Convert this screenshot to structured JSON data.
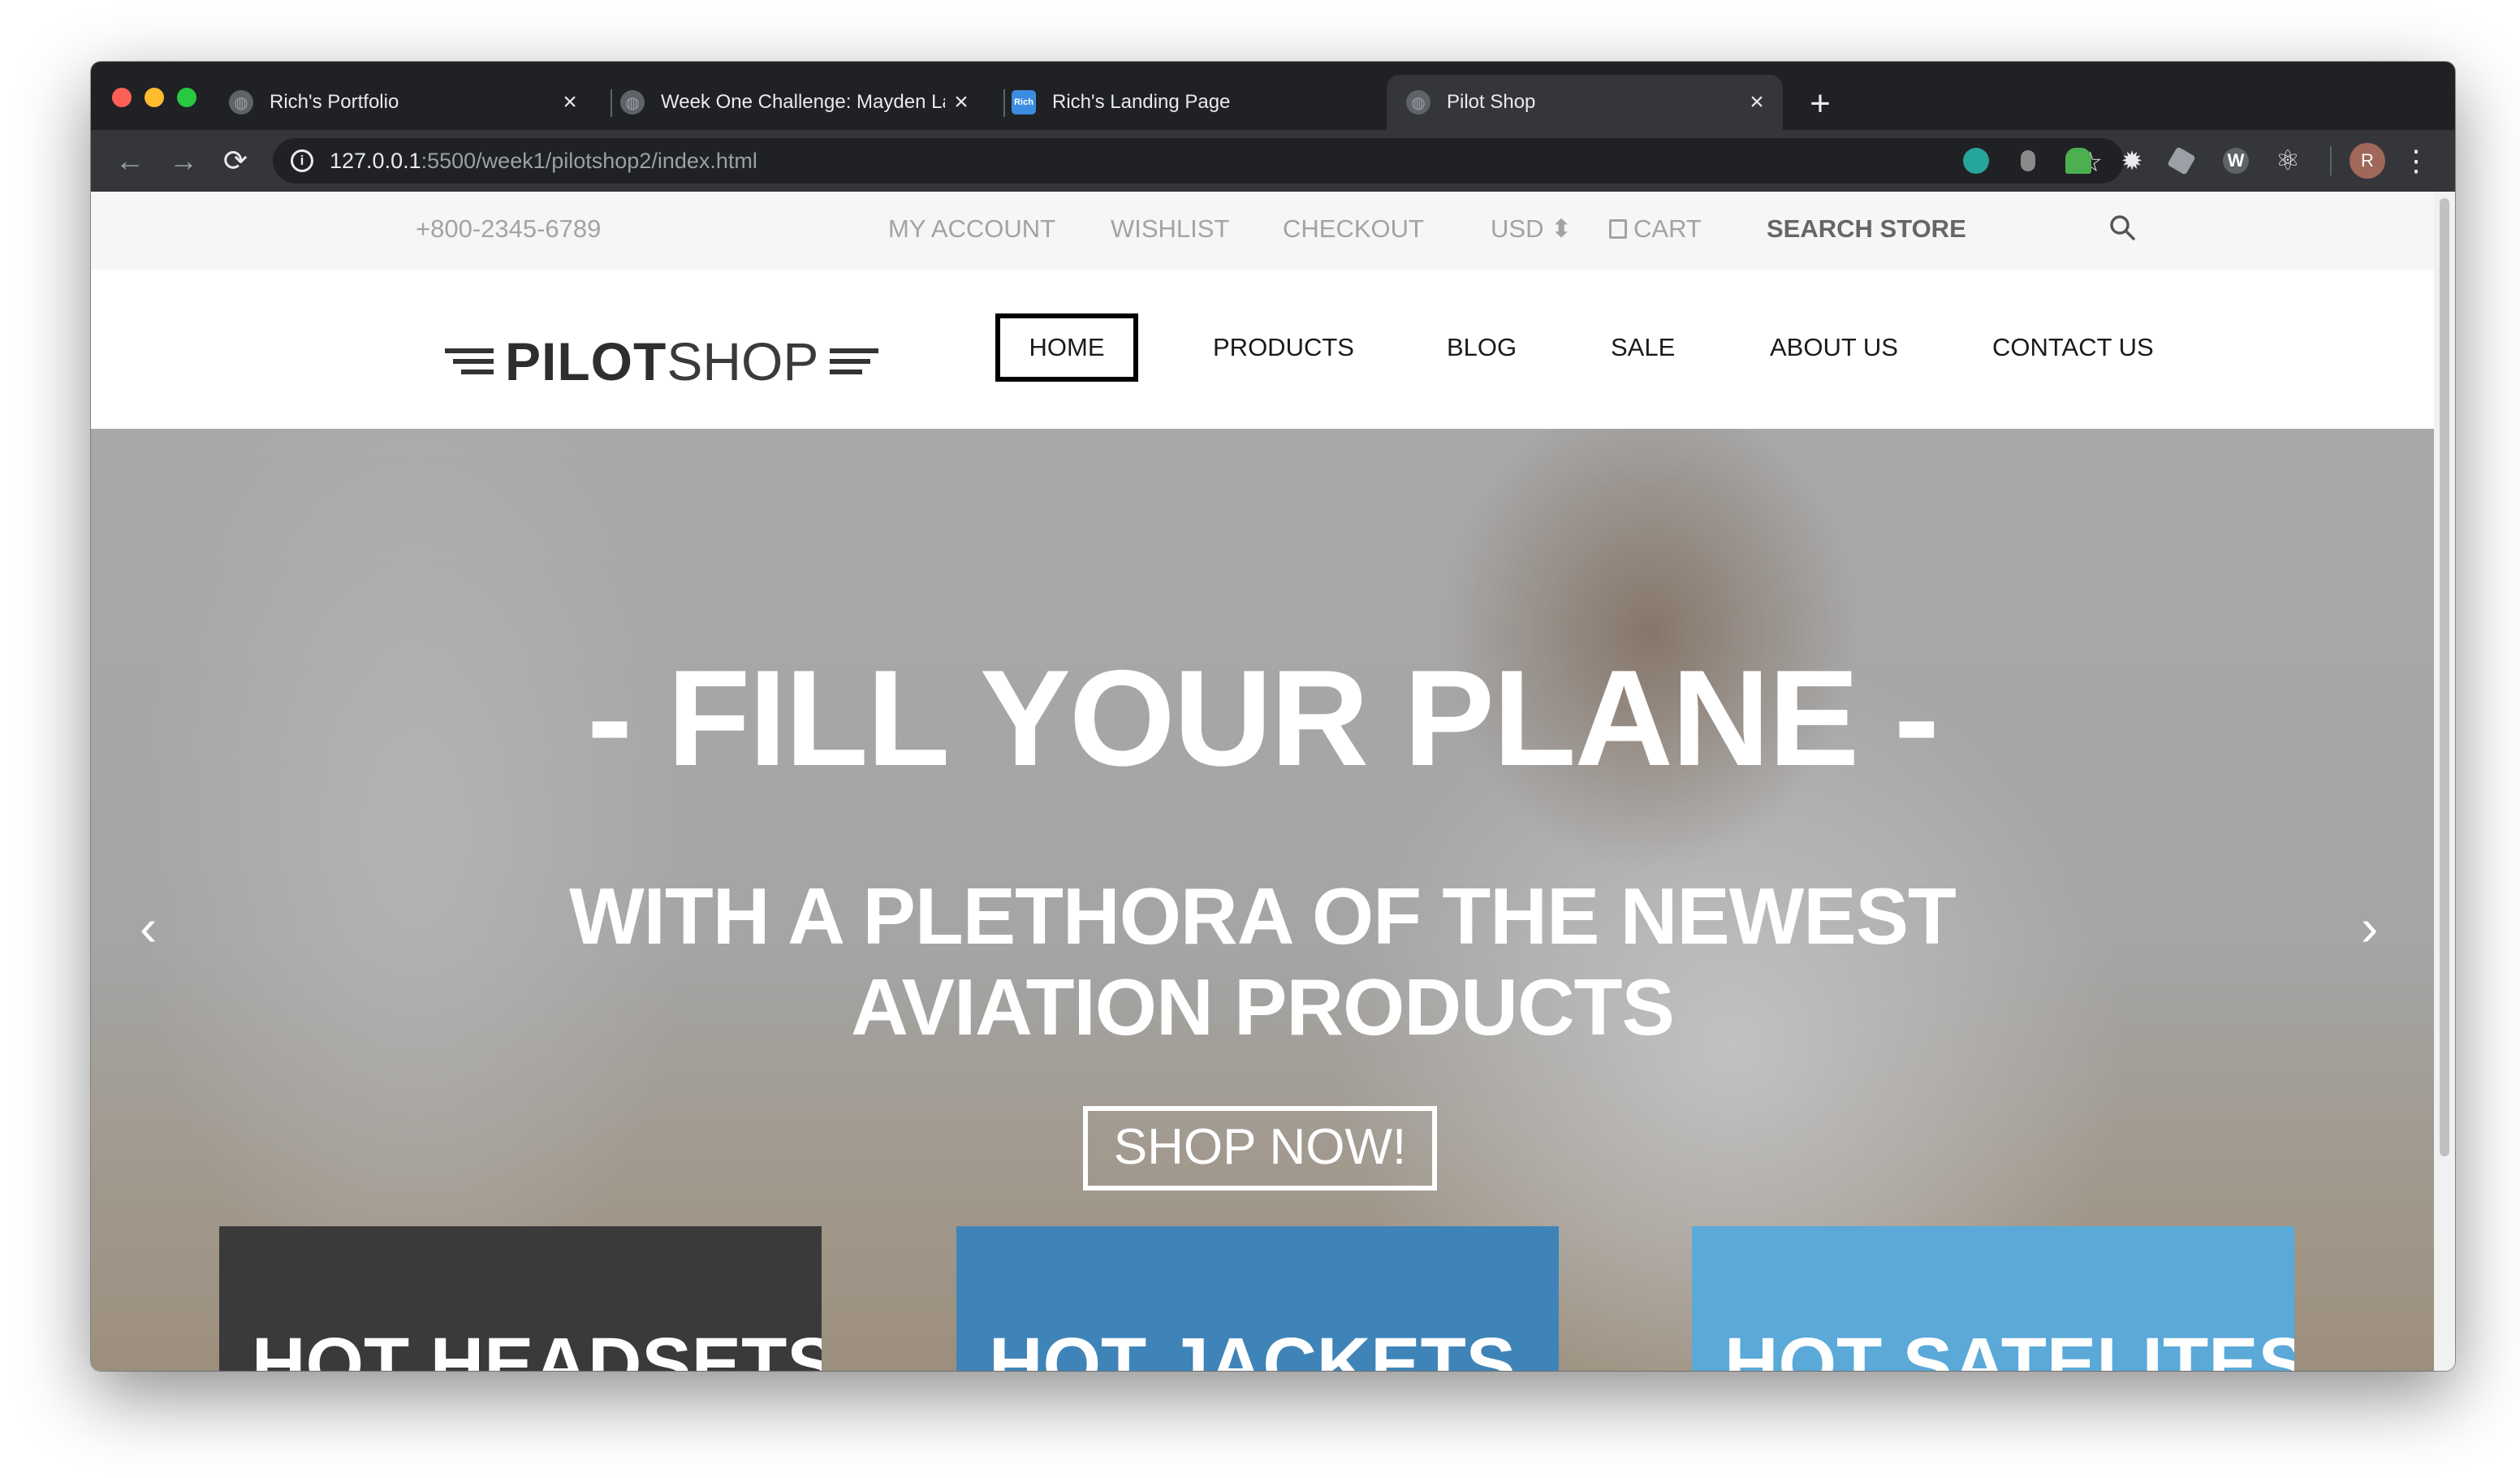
{
  "browser": {
    "tabs": [
      {
        "title": "Rich's Portfolio",
        "favicon": "globe-icon",
        "active": false
      },
      {
        "title": "Week One Challenge: Mayden La",
        "favicon": "globe-icon",
        "active": false
      },
      {
        "title": "Rich's Landing Page",
        "favicon": "rich-favicon",
        "favicon_text": "Rich",
        "active": false
      },
      {
        "title": "Pilot Shop",
        "favicon": "globe-icon",
        "active": true
      }
    ],
    "new_tab": "+",
    "close_glyph": "×",
    "address": {
      "host": "127.0.0.1",
      "path": ":5500/week1/pilotshop2/index.html"
    },
    "info_glyph": "i",
    "back": "←",
    "forward": "→",
    "reload": "⟳",
    "bookmark": "☆",
    "profile_initial": "R",
    "menu": "⋮",
    "extensions": [
      "teal-circle-extension-icon",
      "gray-extension-icon",
      "tree-extension-icon",
      "gear-extension-icon",
      "cube-extension-icon",
      "w-extension-icon",
      "react-extension-icon"
    ]
  },
  "topbar": {
    "phone": "+800-2345-6789",
    "links": [
      "MY ACCOUNT",
      "WISHLIST",
      "CHECKOUT"
    ],
    "currency": "USD ⬍",
    "cart": "CART",
    "search_label": "SEARCH STORE",
    "search_icon": "search-icon"
  },
  "logo": {
    "bold": "PILOT",
    "thin": "SHOP"
  },
  "nav": [
    "HOME",
    "PRODUCTS",
    "BLOG",
    "SALE",
    "ABOUT US",
    "CONTACT US"
  ],
  "hero": {
    "headline": "- FILL YOUR PLANE -",
    "sub_line1": "WITH A PLETHORA OF THE NEWEST",
    "sub_line2": "AVIATION PRODUCTS",
    "cta": "SHOP NOW!",
    "prev": "‹",
    "next": "›"
  },
  "cards": [
    {
      "title": "HOT HEADSETS",
      "color": "#3a3a3a"
    },
    {
      "title": "HOT JACKETS",
      "color": "#3f84b8"
    },
    {
      "title": "HOT SATELITES",
      "color": "#5aa9d8"
    }
  ],
  "colors": {
    "chrome_dark": "#202124",
    "chrome_toolbar": "#35363a",
    "accent_blue": "#3f84b8",
    "accent_light_blue": "#5aa9d8"
  }
}
